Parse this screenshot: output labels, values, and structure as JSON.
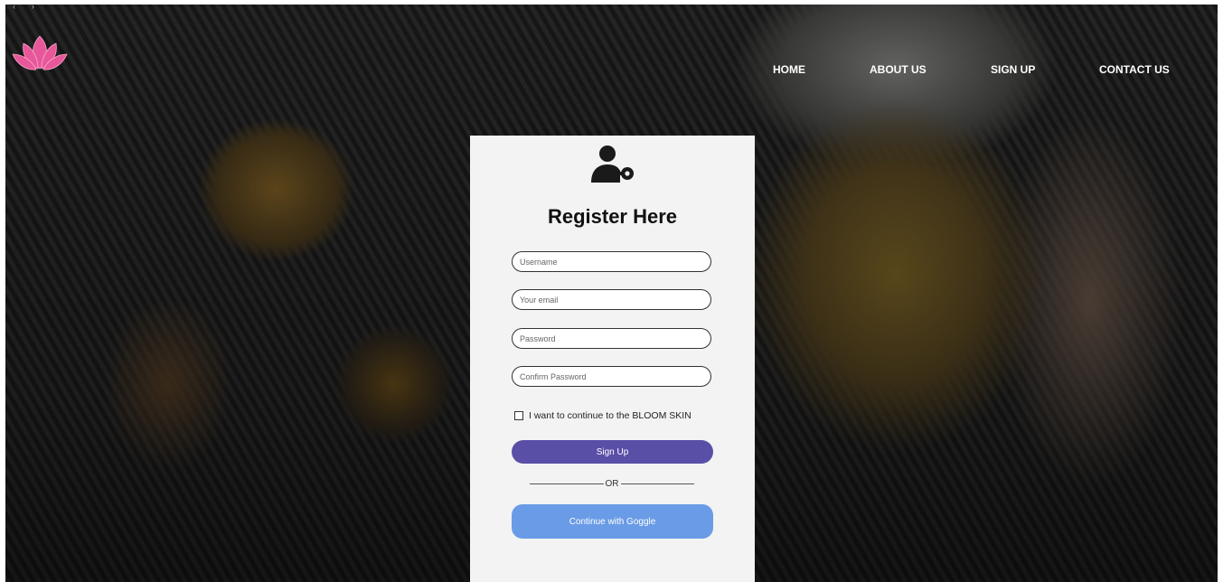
{
  "nav": {
    "home": "HOME",
    "about": "ABOUT US",
    "signup": "SIGN UP",
    "contact": "CONTACT US"
  },
  "logo": {
    "icon": "lotus-logo-icon",
    "color": "#e8579a"
  },
  "form": {
    "icon": "user-key-icon",
    "title": "Register Here",
    "username_placeholder": "Username",
    "email_placeholder": "Your email",
    "password_placeholder": "Password",
    "confirm_placeholder": "Confirm Password",
    "checkbox_label": "I want to continue to the BLOOM SKIN",
    "signup_label": "Sign Up",
    "or_label": "OR",
    "google_label": "Continue with Goggle"
  },
  "colors": {
    "signup_button": "#5a4fa7",
    "google_button": "#6a9be6",
    "card_background": "#f3f3f3"
  }
}
